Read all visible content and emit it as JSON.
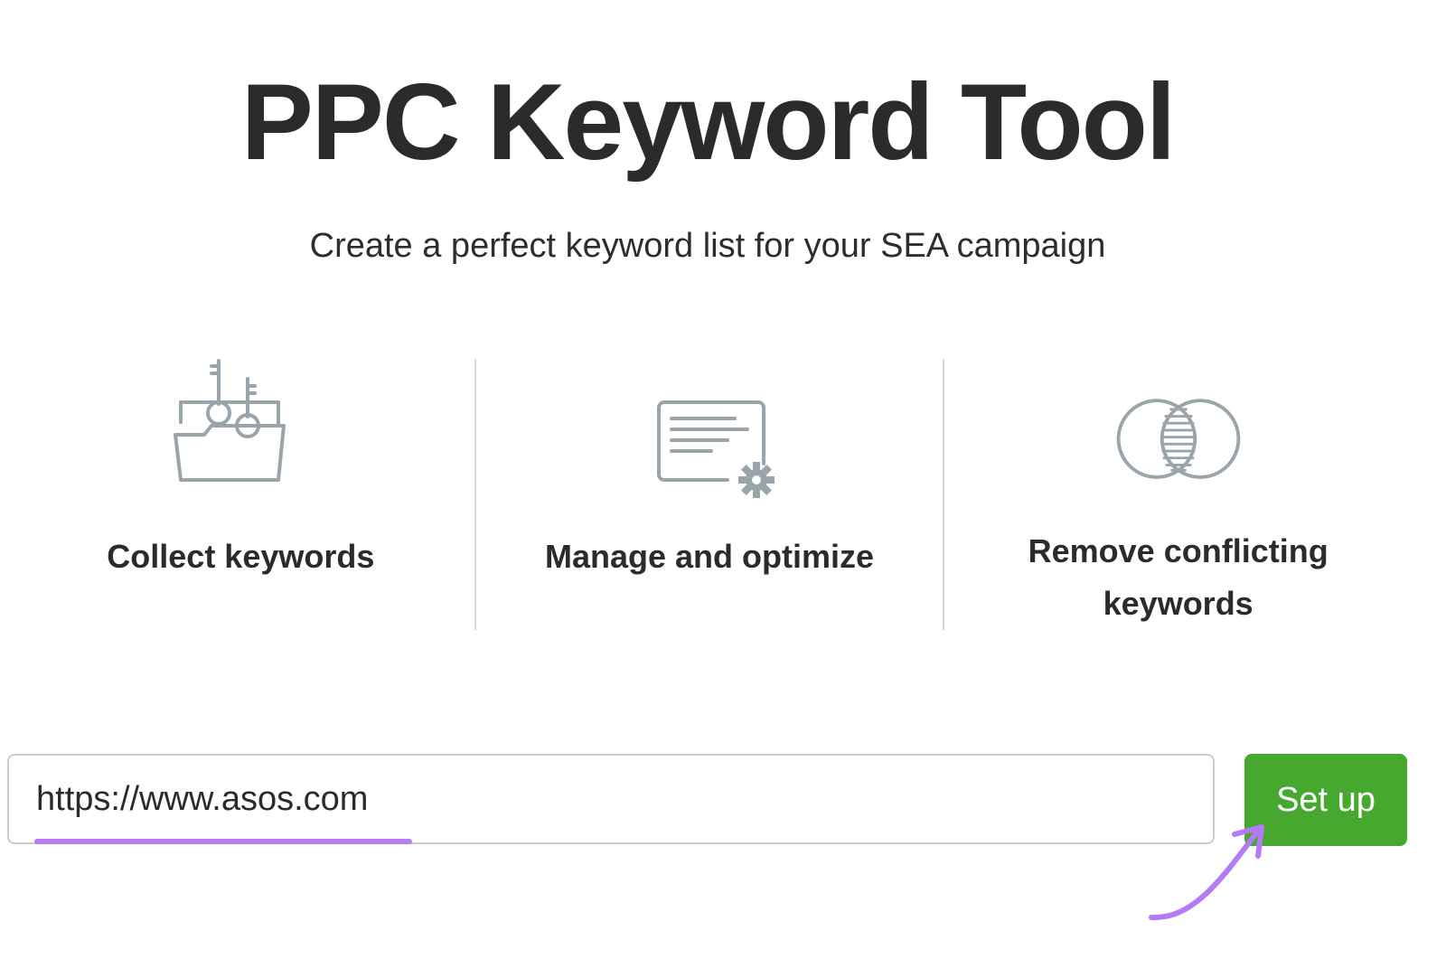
{
  "page": {
    "title": "PPC Keyword Tool",
    "subtitle": "Create a perfect keyword list for your SEA campaign"
  },
  "features": [
    {
      "label": "Collect keywords",
      "icon": "folder-keys-icon"
    },
    {
      "label": "Manage and optimize",
      "icon": "document-gear-icon"
    },
    {
      "label": "Remove conflicting keywords",
      "icon": "overlap-circles-icon"
    }
  ],
  "search": {
    "value": "https://www.asos.com",
    "button_label": "Set up"
  },
  "colors": {
    "accent_green": "#47a82f",
    "highlight_purple": "#b57bf5",
    "icon_gray": "#9aa5ab",
    "text_dark": "#2b2b2b"
  }
}
